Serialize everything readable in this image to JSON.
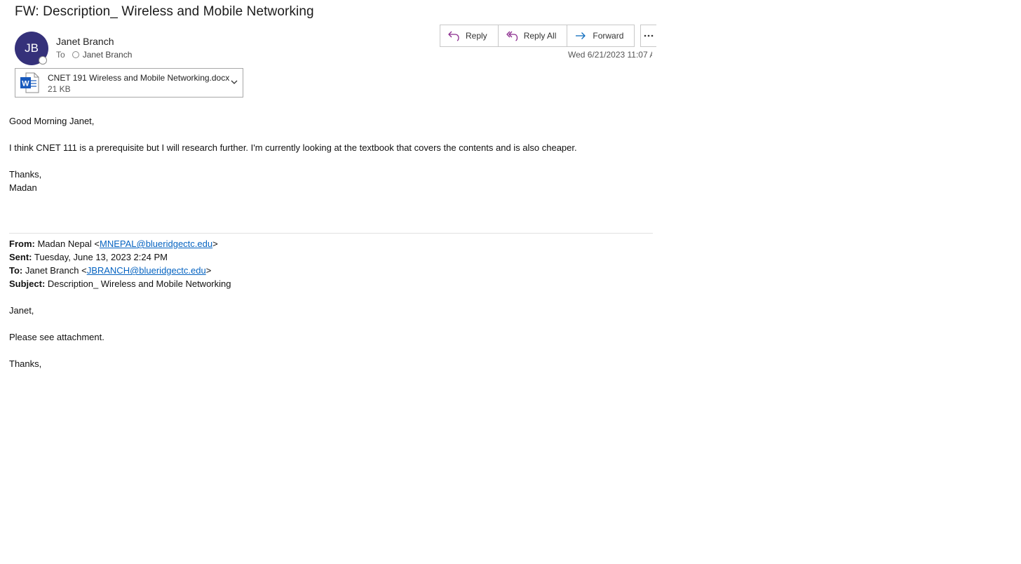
{
  "email": {
    "subject": "FW: Description_ Wireless and Mobile Networking",
    "sender": {
      "initials": "JB",
      "name": "Janet Branch",
      "avatar_color": "#35317a"
    },
    "to_label": "To",
    "recipient": "Janet Branch",
    "timestamp": "Wed 6/21/2023 11:07 A",
    "actions": {
      "reply": "Reply",
      "reply_all": "Reply All",
      "forward": "Forward",
      "more_icon": "ellipsis-icon"
    },
    "attachment": {
      "name": "CNET 191 Wireless and Mobile Networking.docx",
      "size": "21 KB",
      "icon": "word-doc-icon"
    },
    "body": {
      "greeting": "Good Morning Janet,",
      "line1": "I think CNET 111 is a prerequisite but I will research further. I'm currently looking at the textbook that covers the contents and is also cheaper.",
      "closing": "Thanks,",
      "signature": "Madan"
    },
    "forwarded": {
      "from_label": "From:",
      "from_name": "Madan Nepal <",
      "from_email": "MNEPAL@blueridgectc.edu",
      "from_end": ">",
      "sent_label": "Sent:",
      "sent_value": "Tuesday, June 13, 2023 2:24 PM",
      "to_label": "To:",
      "to_name": "Janet Branch <",
      "to_email": "JBRANCH@blueridgectc.edu",
      "to_end": ">",
      "subject_label": "Subject:",
      "subject_value": "Description_ Wireless and Mobile Networking",
      "greeting": "Janet,",
      "line1": "Please see attachment.",
      "closing": "Thanks,"
    },
    "colors": {
      "accent_purple": "#8c2d8f",
      "forward_blue": "#0f6cbd",
      "link": "#0563c1",
      "word_blue": "#185abd"
    }
  }
}
